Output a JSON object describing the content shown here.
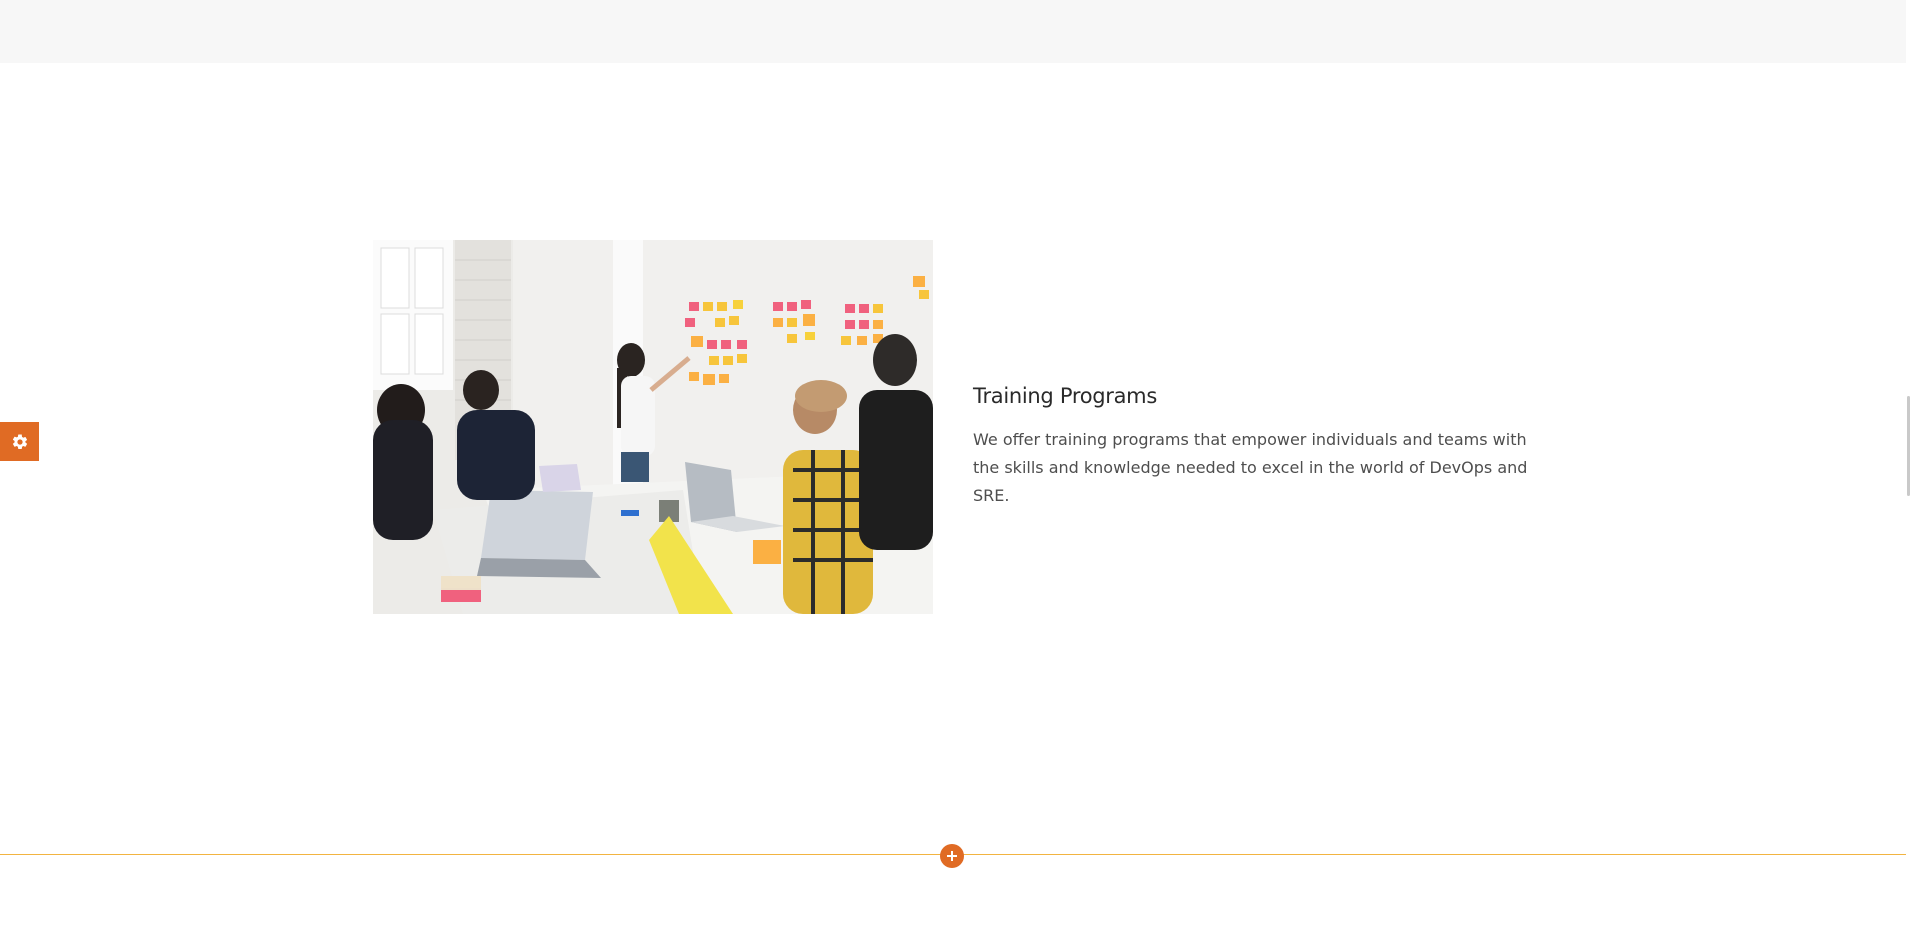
{
  "feature": {
    "title": "Training Programs",
    "description": "We offer training programs that empower individuals and teams with the skills and knowledge needed to excel in the world of DevOps and SRE."
  },
  "icons": {
    "settings": "gear-icon",
    "add": "plus-icon"
  },
  "colors": {
    "accent": "#e06b24",
    "divider": "#f2b441",
    "top_band": "#f7f7f7"
  }
}
